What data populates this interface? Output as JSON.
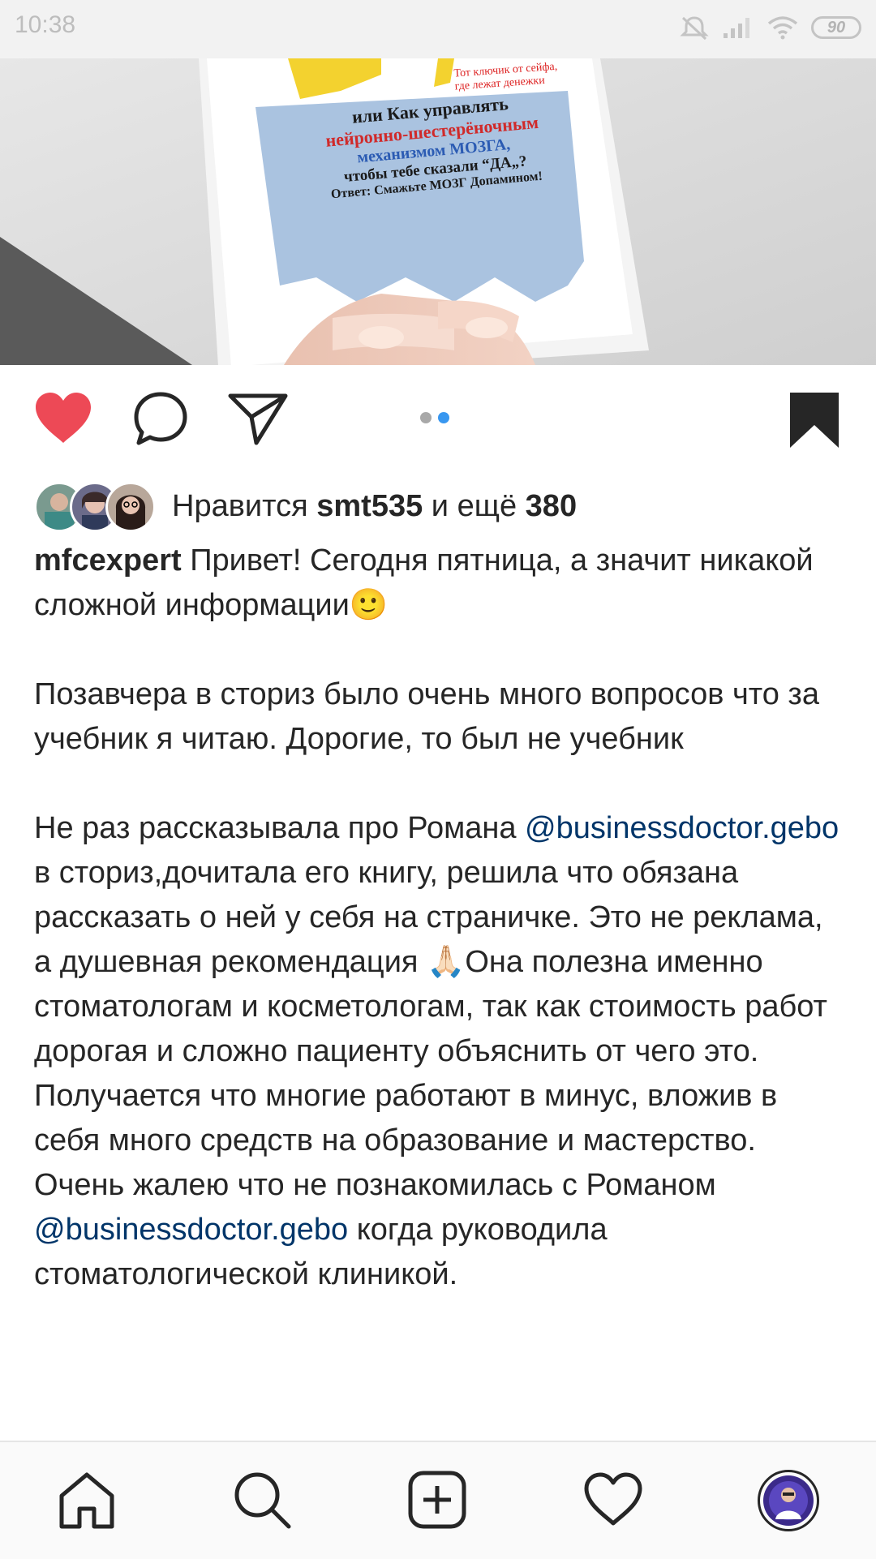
{
  "status_bar": {
    "time": "10:38",
    "battery": "90",
    "icons": [
      "mute-icon",
      "signal-icon",
      "wifi-icon",
      "battery-icon"
    ]
  },
  "post": {
    "image_text": {
      "line_top_red": "Тот ключик от сейфа,",
      "line_top_red2": "где лежат денежки",
      "line1": "или Как управлять",
      "line2": "нейронно-шестерёночным",
      "line3": "механизмом МОЗГА,",
      "line4": "чтобы тебе сказали “ДА„?",
      "line5": "Ответ: Смажьте МОЗГ Допамином!"
    },
    "carousel": {
      "count": 2,
      "active": 1
    },
    "likes": {
      "prefix": "Нравится ",
      "user": "smt535",
      "middle": " и ещё ",
      "count": "380"
    },
    "caption": {
      "username": "mfcexpert",
      "p1": "Привет! Сегодня пятница, а значит никакой сложной информации🙂",
      "p2": "Позавчера в сториз было очень много вопросов что за учебник я читаю. Дорогие, то был не учебник",
      "p3_a": "Не раз рассказывала про Романа ",
      "mention1": "@businessdoctor.gebo",
      "p3_b": " в сториз,дочитала его книгу, решила что обязана рассказать о ней у себя на страничке. Это не реклама, а душевная рекомендация 🙏🏻Она полезна именно стоматологам и косметологам, так как стоимость работ дорогая и сложно пациенту объяснить от чего это. Получается что многие работают  в минус, вложив в себя много средств на образование и мастерство. Очень жалею что не познакомилась с Романом ",
      "mention2": "@businessdoctor.gebo",
      "p3_c": " когда руководила стоматологической клиникой."
    }
  },
  "colors": {
    "like_red": "#ed4956",
    "link_blue": "#003569",
    "dot_active": "#3897f0"
  },
  "bottom_nav": [
    "home-icon",
    "search-icon",
    "add-post-icon",
    "activity-heart-icon",
    "profile-avatar"
  ]
}
